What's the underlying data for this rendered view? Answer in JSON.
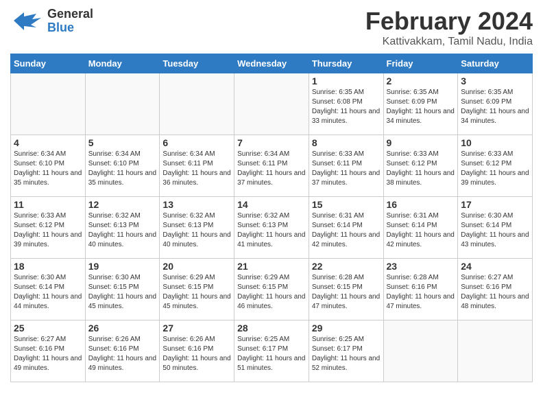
{
  "header": {
    "logo_general": "General",
    "logo_blue": "Blue",
    "month_title": "February 2024",
    "subtitle": "Kattivakkam, Tamil Nadu, India"
  },
  "calendar": {
    "days_of_week": [
      "Sunday",
      "Monday",
      "Tuesday",
      "Wednesday",
      "Thursday",
      "Friday",
      "Saturday"
    ],
    "weeks": [
      [
        {
          "day": "",
          "info": ""
        },
        {
          "day": "",
          "info": ""
        },
        {
          "day": "",
          "info": ""
        },
        {
          "day": "",
          "info": ""
        },
        {
          "day": "1",
          "info": "Sunrise: 6:35 AM\nSunset: 6:08 PM\nDaylight: 11 hours\nand 33 minutes."
        },
        {
          "day": "2",
          "info": "Sunrise: 6:35 AM\nSunset: 6:09 PM\nDaylight: 11 hours\nand 34 minutes."
        },
        {
          "day": "3",
          "info": "Sunrise: 6:35 AM\nSunset: 6:09 PM\nDaylight: 11 hours\nand 34 minutes."
        }
      ],
      [
        {
          "day": "4",
          "info": "Sunrise: 6:34 AM\nSunset: 6:10 PM\nDaylight: 11 hours\nand 35 minutes."
        },
        {
          "day": "5",
          "info": "Sunrise: 6:34 AM\nSunset: 6:10 PM\nDaylight: 11 hours\nand 35 minutes."
        },
        {
          "day": "6",
          "info": "Sunrise: 6:34 AM\nSunset: 6:11 PM\nDaylight: 11 hours\nand 36 minutes."
        },
        {
          "day": "7",
          "info": "Sunrise: 6:34 AM\nSunset: 6:11 PM\nDaylight: 11 hours\nand 37 minutes."
        },
        {
          "day": "8",
          "info": "Sunrise: 6:33 AM\nSunset: 6:11 PM\nDaylight: 11 hours\nand 37 minutes."
        },
        {
          "day": "9",
          "info": "Sunrise: 6:33 AM\nSunset: 6:12 PM\nDaylight: 11 hours\nand 38 minutes."
        },
        {
          "day": "10",
          "info": "Sunrise: 6:33 AM\nSunset: 6:12 PM\nDaylight: 11 hours\nand 39 minutes."
        }
      ],
      [
        {
          "day": "11",
          "info": "Sunrise: 6:33 AM\nSunset: 6:12 PM\nDaylight: 11 hours\nand 39 minutes."
        },
        {
          "day": "12",
          "info": "Sunrise: 6:32 AM\nSunset: 6:13 PM\nDaylight: 11 hours\nand 40 minutes."
        },
        {
          "day": "13",
          "info": "Sunrise: 6:32 AM\nSunset: 6:13 PM\nDaylight: 11 hours\nand 40 minutes."
        },
        {
          "day": "14",
          "info": "Sunrise: 6:32 AM\nSunset: 6:13 PM\nDaylight: 11 hours\nand 41 minutes."
        },
        {
          "day": "15",
          "info": "Sunrise: 6:31 AM\nSunset: 6:14 PM\nDaylight: 11 hours\nand 42 minutes."
        },
        {
          "day": "16",
          "info": "Sunrise: 6:31 AM\nSunset: 6:14 PM\nDaylight: 11 hours\nand 42 minutes."
        },
        {
          "day": "17",
          "info": "Sunrise: 6:30 AM\nSunset: 6:14 PM\nDaylight: 11 hours\nand 43 minutes."
        }
      ],
      [
        {
          "day": "18",
          "info": "Sunrise: 6:30 AM\nSunset: 6:14 PM\nDaylight: 11 hours\nand 44 minutes."
        },
        {
          "day": "19",
          "info": "Sunrise: 6:30 AM\nSunset: 6:15 PM\nDaylight: 11 hours\nand 45 minutes."
        },
        {
          "day": "20",
          "info": "Sunrise: 6:29 AM\nSunset: 6:15 PM\nDaylight: 11 hours\nand 45 minutes."
        },
        {
          "day": "21",
          "info": "Sunrise: 6:29 AM\nSunset: 6:15 PM\nDaylight: 11 hours\nand 46 minutes."
        },
        {
          "day": "22",
          "info": "Sunrise: 6:28 AM\nSunset: 6:15 PM\nDaylight: 11 hours\nand 47 minutes."
        },
        {
          "day": "23",
          "info": "Sunrise: 6:28 AM\nSunset: 6:16 PM\nDaylight: 11 hours\nand 47 minutes."
        },
        {
          "day": "24",
          "info": "Sunrise: 6:27 AM\nSunset: 6:16 PM\nDaylight: 11 hours\nand 48 minutes."
        }
      ],
      [
        {
          "day": "25",
          "info": "Sunrise: 6:27 AM\nSunset: 6:16 PM\nDaylight: 11 hours\nand 49 minutes."
        },
        {
          "day": "26",
          "info": "Sunrise: 6:26 AM\nSunset: 6:16 PM\nDaylight: 11 hours\nand 49 minutes."
        },
        {
          "day": "27",
          "info": "Sunrise: 6:26 AM\nSunset: 6:16 PM\nDaylight: 11 hours\nand 50 minutes."
        },
        {
          "day": "28",
          "info": "Sunrise: 6:25 AM\nSunset: 6:17 PM\nDaylight: 11 hours\nand 51 minutes."
        },
        {
          "day": "29",
          "info": "Sunrise: 6:25 AM\nSunset: 6:17 PM\nDaylight: 11 hours\nand 52 minutes."
        },
        {
          "day": "",
          "info": ""
        },
        {
          "day": "",
          "info": ""
        }
      ]
    ]
  }
}
